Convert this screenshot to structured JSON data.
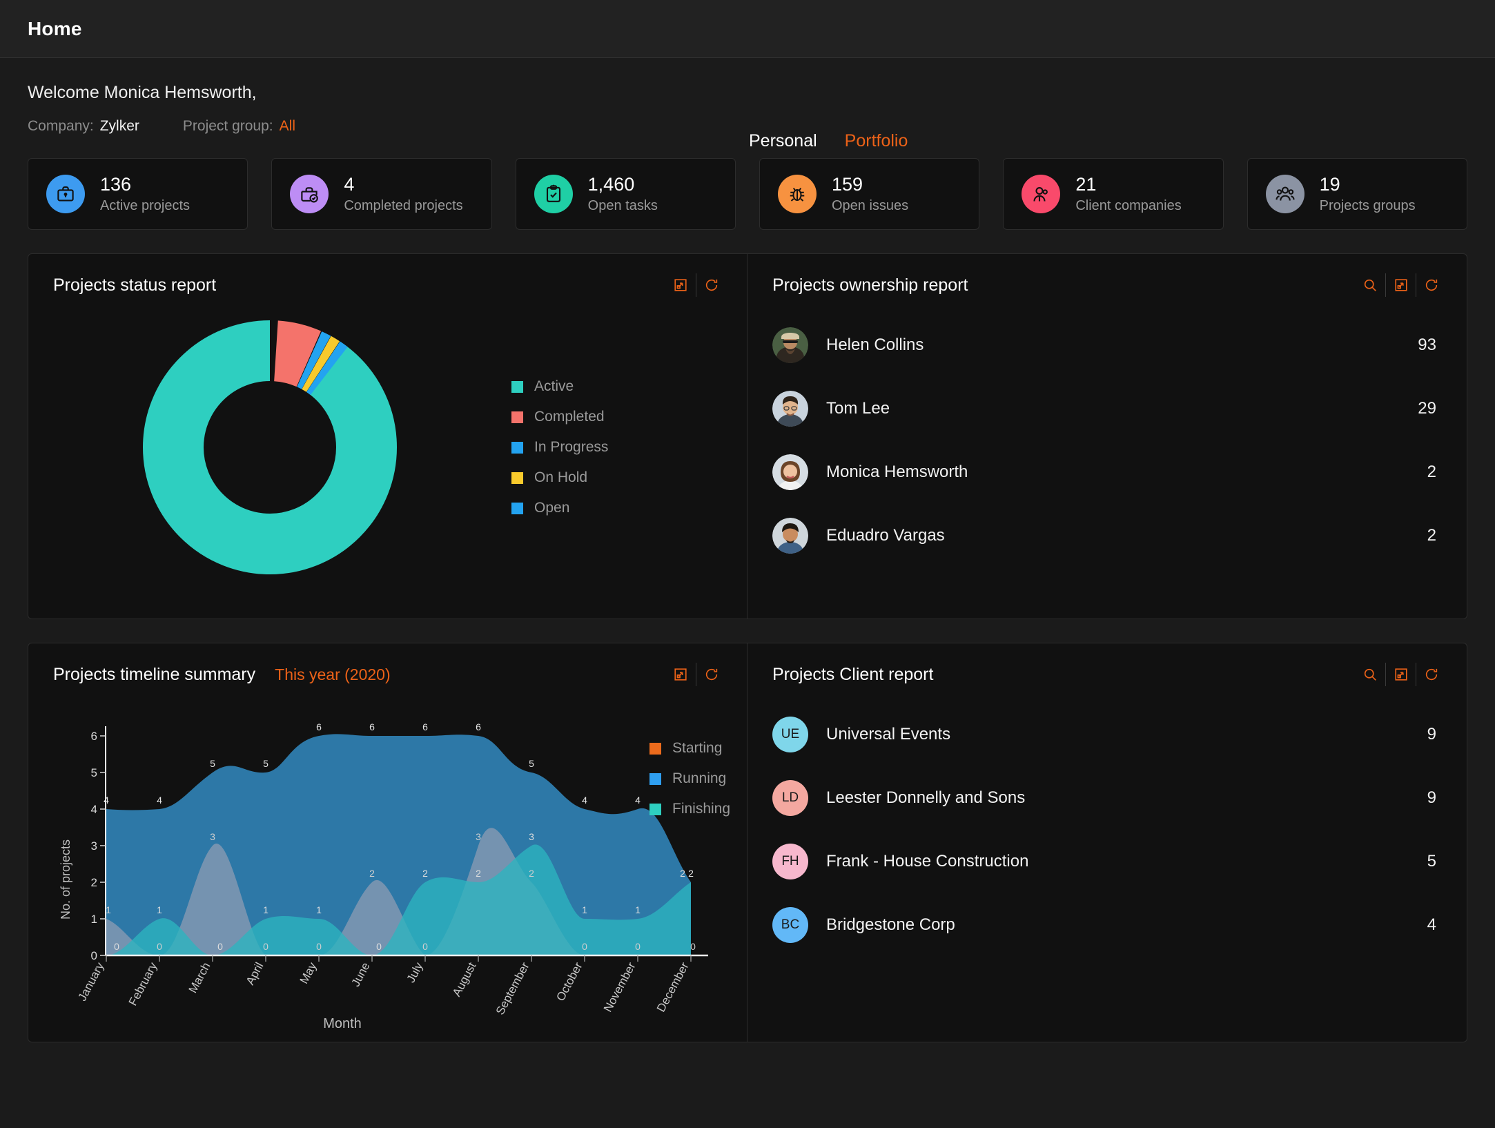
{
  "topbar": {
    "title": "Home"
  },
  "welcome": {
    "greeting": "Welcome Monica Hemsworth,",
    "company_label": "Company:",
    "company_value": "Zylker",
    "group_label": "Project group:",
    "group_value": "All"
  },
  "scope_tabs": [
    {
      "label": "Personal",
      "active": false
    },
    {
      "label": "Portfolio",
      "active": true
    }
  ],
  "stats": [
    {
      "value": "136",
      "label": "Active projects",
      "icon": "briefcase-icon",
      "color": "#3d9bf0"
    },
    {
      "value": "4",
      "label": "Completed projects",
      "icon": "briefcase-check-icon",
      "color": "#bd8df5"
    },
    {
      "value": "1,460",
      "label": "Open tasks",
      "icon": "clipboard-check-icon",
      "color": "#1fcfa5"
    },
    {
      "value": "159",
      "label": "Open issues",
      "icon": "bug-icon",
      "color": "#f79240"
    },
    {
      "value": "21",
      "label": "Client companies",
      "icon": "client-users-icon",
      "color": "#f94a6b"
    },
    {
      "value": "19",
      "label": "Projects groups",
      "icon": "group-users-icon",
      "color": "#8b93a3"
    }
  ],
  "status_panel": {
    "title": "Projects status report",
    "actions": [
      "expand-icon",
      "refresh-icon"
    ]
  },
  "ownership_panel": {
    "title": "Projects ownership report",
    "actions": [
      "search-icon",
      "expand-icon",
      "refresh-icon"
    ],
    "rows": [
      {
        "name": "Helen Collins",
        "count": "93",
        "avatar": "photo-helen"
      },
      {
        "name": "Tom Lee",
        "count": "29",
        "avatar": "photo-tom"
      },
      {
        "name": "Monica Hemsworth",
        "count": "2",
        "avatar": "photo-monica"
      },
      {
        "name": "Eduadro Vargas",
        "count": "2",
        "avatar": "photo-eduadro"
      }
    ]
  },
  "timeline_panel": {
    "title": "Projects timeline summary",
    "subtitle": "This year (2020)",
    "actions": [
      "expand-icon",
      "refresh-icon"
    ]
  },
  "client_panel": {
    "title": "Projects Client report",
    "actions": [
      "search-icon",
      "expand-icon",
      "refresh-icon"
    ],
    "rows": [
      {
        "initials": "UE",
        "name": "Universal Events",
        "count": "9",
        "color": "#7fd6ea"
      },
      {
        "initials": "LD",
        "name": "Leester Donnelly and Sons",
        "count": "9",
        "color": "#f4a8a0"
      },
      {
        "initials": "FH",
        "name": "Frank - House Construction",
        "count": "5",
        "color": "#f7b8cd"
      },
      {
        "initials": "BC",
        "name": "Bridgestone Corp",
        "count": "4",
        "color": "#62b8f7"
      }
    ]
  },
  "chart_data": [
    {
      "type": "pie",
      "title": "Projects status report",
      "variant": "donut",
      "legend_position": "right",
      "categories": [
        "Active",
        "Completed",
        "In Progress",
        "On Hold",
        "Open"
      ],
      "values": [
        136,
        4,
        1,
        1,
        1
      ],
      "colors": [
        "#2ecfc0",
        "#f4736b",
        "#23a3f0",
        "#f8ca2c",
        "#23a3f0"
      ],
      "start_angle_deg": 0,
      "inner_radius_ratio": 0.58
    },
    {
      "type": "area",
      "title": "Projects timeline summary",
      "subtitle": "This year (2020)",
      "xlabel": "Month",
      "ylabel": "No. of projects",
      "ylim": [
        0,
        6
      ],
      "yticks": [
        0,
        1,
        2,
        3,
        4,
        5,
        6
      ],
      "grid": false,
      "legend_position": "right",
      "stacked": false,
      "categories": [
        "January",
        "February",
        "March",
        "April",
        "May",
        "June",
        "July",
        "August",
        "September",
        "October",
        "November",
        "December"
      ],
      "series": [
        {
          "name": "Starting",
          "color": "#ec6b1c",
          "values": [
            1,
            0,
            3,
            0,
            0,
            2,
            0,
            3,
            2,
            0,
            0,
            0
          ]
        },
        {
          "name": "Running",
          "color": "#2f9ff0",
          "values": [
            4,
            4,
            5,
            5,
            6,
            6,
            6,
            6,
            5,
            4,
            4,
            2
          ]
        },
        {
          "name": "Finishing",
          "color": "#2ecfc0",
          "values": [
            0,
            1,
            0,
            1,
            1,
            0,
            2,
            2,
            3,
            1,
            1,
            2
          ]
        }
      ]
    }
  ]
}
